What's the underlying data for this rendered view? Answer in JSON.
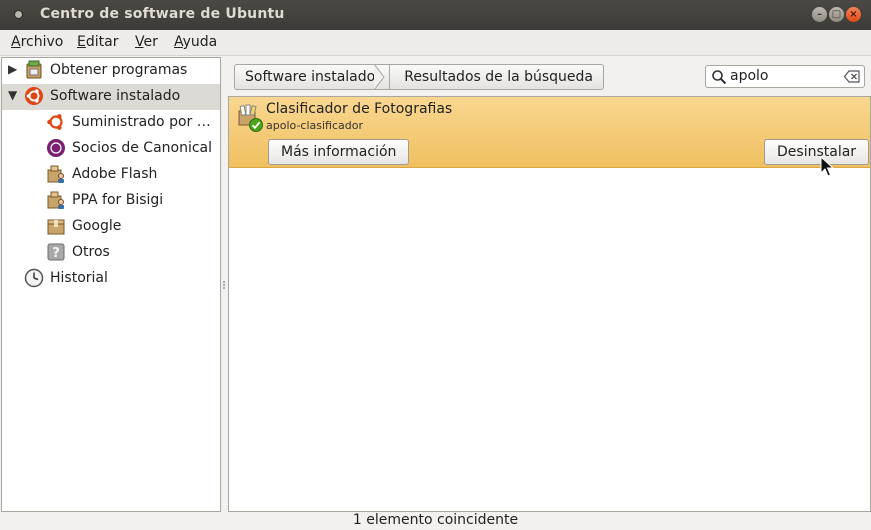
{
  "window": {
    "title": "Centro de software de Ubuntu"
  },
  "menubar": {
    "items": [
      {
        "label": "Archivo",
        "mnemonic": "A",
        "rest": "rchivo"
      },
      {
        "label": "Editar",
        "mnemonic": "E",
        "rest": "ditar"
      },
      {
        "label": "Ver",
        "mnemonic": "V",
        "rest": "er"
      },
      {
        "label": "Ayuda",
        "mnemonic": "A",
        "rest": "yuda"
      }
    ]
  },
  "sidebar": {
    "items": [
      {
        "label": "Obtener programas",
        "icon": "software-center-icon",
        "expander": "▶"
      },
      {
        "label": "Software instalado",
        "icon": "ubuntu-logo-icon",
        "expander": "▼",
        "selected": true
      },
      {
        "label": "Suministrado por …",
        "icon": "ubuntu-circle-icon"
      },
      {
        "label": "Socios de Canonical",
        "icon": "canonical-icon"
      },
      {
        "label": "Adobe Flash",
        "icon": "package-person-icon"
      },
      {
        "label": "PPA for Bisigi",
        "icon": "package-person-icon"
      },
      {
        "label": "Google",
        "icon": "package-icon"
      },
      {
        "label": "Otros",
        "icon": "unknown-question-icon"
      },
      {
        "label": "Historial",
        "icon": "clock-icon"
      }
    ]
  },
  "breadcrumb": {
    "first": "Software instalado",
    "second": "Resultados de la búsqueda"
  },
  "search": {
    "value": "apolo"
  },
  "results": [
    {
      "name": "Clasificador de Fotografias",
      "package": "apolo-clasificador",
      "more_label": "Más información",
      "action_label": "Desinstalar",
      "installed": true
    }
  ],
  "status": {
    "text": "1 elemento coincidente"
  },
  "colors": {
    "selection": "#f0c060",
    "ubuntu_orange": "#dd4814",
    "canonical_purple": "#77216f"
  }
}
